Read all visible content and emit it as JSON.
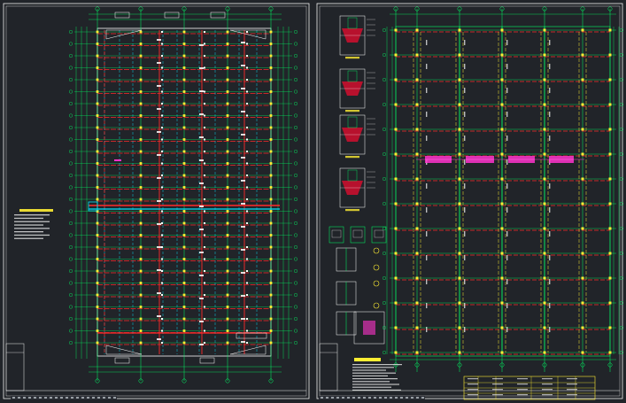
{
  "viewer": {
    "background": "#212429",
    "sheet_count": 2
  },
  "sheets": [
    {
      "name": "foundation-beam-plan",
      "colors": {
        "frame": "#ffffff",
        "axis": "#00ff66",
        "beam_main": "#ff2a2a",
        "beam_secondary": "#00e5ff",
        "column": "#ffee33",
        "highlight": "#ff33cc"
      }
    },
    {
      "name": "column-grid-plan-and-details",
      "colors": {
        "frame": "#ffffff",
        "axis": "#00ff66",
        "beam_main": "#ff2a2a",
        "column": "#ffee33",
        "highlight": "#ff33cc",
        "title_block": "#ffee33"
      }
    }
  ],
  "icons": [
    "zoom-extent-icon"
  ]
}
